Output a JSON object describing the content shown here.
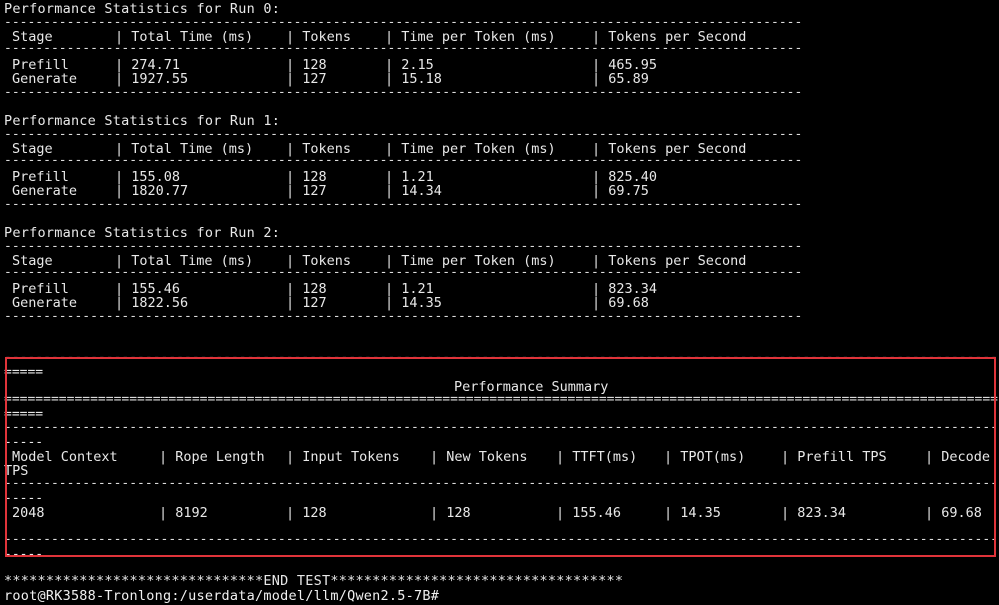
{
  "runs": [
    {
      "title": "Performance Statistics for Run 0:",
      "headers": [
        "Stage",
        "| Total Time (ms)",
        "| Tokens",
        "| Time per Token (ms)",
        "| Tokens per Second"
      ],
      "rows": [
        [
          "Prefill",
          "| 274.71",
          "| 128",
          "| 2.15",
          "| 465.95"
        ],
        [
          "Generate",
          "| 1927.55",
          "| 127",
          "| 15.18",
          "| 65.89"
        ]
      ]
    },
    {
      "title": "Performance Statistics for Run 1:",
      "headers": [
        "Stage",
        "| Total Time (ms)",
        "| Tokens",
        "| Time per Token (ms)",
        "| Tokens per Second"
      ],
      "rows": [
        [
          "Prefill",
          "| 155.08",
          "| 128",
          "| 1.21",
          "| 825.40"
        ],
        [
          "Generate",
          "| 1820.77",
          "| 127",
          "| 14.34",
          "| 69.75"
        ]
      ]
    },
    {
      "title": "Performance Statistics for Run 2:",
      "headers": [
        "Stage",
        "| Total Time (ms)",
        "| Tokens",
        "| Time per Token (ms)",
        "| Tokens per Second"
      ],
      "rows": [
        [
          "Prefill",
          "| 155.46",
          "| 128",
          "| 1.21",
          "| 823.34"
        ],
        [
          "Generate",
          "| 1822.56",
          "| 127",
          "| 14.35",
          "| 69.68"
        ]
      ]
    }
  ],
  "summary": {
    "eq_short": "=====",
    "dash_short": "-----",
    "title": "Performance Summary",
    "headers": [
      "Model Context",
      "| Rope Length",
      "| Input Tokens",
      "| New Tokens",
      "| TTFT(ms)",
      "| TPOT(ms)",
      "| Prefill TPS",
      "| Decode"
    ],
    "header_wrap": "TPS",
    "values": [
      "2048",
      "| 8192",
      "| 128",
      "| 128",
      "| 155.46",
      "| 14.35",
      "| 823.34",
      "| 69.68"
    ]
  },
  "end_line": "*******************************END TEST***********************************",
  "prompt": "root@RK3588-Tronlong:/userdata/model/llm/Qwen2.5-7B#",
  "colors": {
    "background": "#000000",
    "text": "#e8e8e8",
    "highlight_border": "#e0343a"
  }
}
